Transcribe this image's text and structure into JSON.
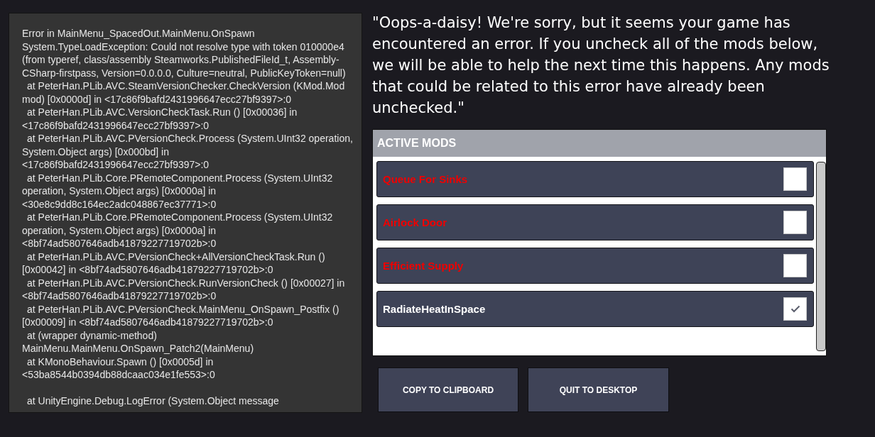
{
  "log_blocks": [
    [
      {
        "kind": "text",
        "text": "Error in MainMenu_SpacedOut.MainMenu.OnSpawn"
      },
      {
        "kind": "text",
        "text": "System.TypeLoadException: Could not resolve type with token 010000e4"
      },
      {
        "kind": "text",
        "text": "(from typeref, class/assembly Steamworks.PublishedFileId_t, Assembly-"
      },
      {
        "kind": "text",
        "text": "CSharp-firstpass, Version=0.0.0.0, Culture=neutral, PublicKeyToken=null)"
      },
      {
        "kind": "frame",
        "text": "at PeterHan.PLib.AVC.SteamVersionChecker.CheckVersion (KMod.Mod"
      },
      {
        "kind": "text",
        "text": "mod) [0x0000d] in <17c86f9bafd2431996647ecc27bf9397>:0"
      },
      {
        "kind": "frame",
        "text": "at PeterHan.PLib.AVC.VersionCheckTask.Run () [0x00036] in"
      },
      {
        "kind": "text",
        "text": "<17c86f9bafd2431996647ecc27bf9397>:0"
      },
      {
        "kind": "frame",
        "text": "at PeterHan.PLib.AVC.PVersionCheck.Process (System.UInt32 operation,"
      },
      {
        "kind": "text",
        "text": "System.Object args) [0x000bd] in"
      },
      {
        "kind": "text",
        "text": "<17c86f9bafd2431996647ecc27bf9397>:0"
      },
      {
        "kind": "frame",
        "text": "at PeterHan.PLib.Core.PRemoteComponent.Process (System.UInt32"
      },
      {
        "kind": "text",
        "text": "operation, System.Object args) [0x0000a] in"
      },
      {
        "kind": "text",
        "text": "<30e8c9dd8c164ec2adc048867ec37771>:0"
      },
      {
        "kind": "frame",
        "text": "at PeterHan.PLib.Core.PRemoteComponent.Process (System.UInt32"
      },
      {
        "kind": "text",
        "text": "operation, System.Object args) [0x0000a] in"
      },
      {
        "kind": "text",
        "text": "<8bf74ad5807646adb41879227719702b>:0"
      },
      {
        "kind": "frame",
        "text": "at PeterHan.PLib.AVC.PVersionCheck+AllVersionCheckTask.Run ()"
      },
      {
        "kind": "text",
        "text": "[0x00042] in <8bf74ad5807646adb41879227719702b>:0"
      },
      {
        "kind": "frame",
        "text": "at PeterHan.PLib.AVC.PVersionCheck.RunVersionCheck () [0x00027] in"
      },
      {
        "kind": "text",
        "text": "<8bf74ad5807646adb41879227719702b>:0"
      },
      {
        "kind": "frame",
        "text": "at PeterHan.PLib.AVC.PVersionCheck.MainMenu_OnSpawn_Postfix ()"
      },
      {
        "kind": "text",
        "text": "[0x00009] in <8bf74ad5807646adb41879227719702b>:0"
      },
      {
        "kind": "frame",
        "text": "at (wrapper dynamic-method)"
      },
      {
        "kind": "text",
        "text": "MainMenu.MainMenu.OnSpawn_Patch2(MainMenu)"
      },
      {
        "kind": "frame",
        "text": "at KMonoBehaviour.Spawn () [0x0005d] in"
      },
      {
        "kind": "text",
        "text": "<53ba8544b0394db88dcaac034e1fe553>:0"
      }
    ],
    [
      {
        "kind": "frame",
        "text": "at UnityEngine.Debug.LogError (System.Object message"
      }
    ]
  ],
  "message": "\"Oops-a-daisy! We're sorry, but it seems your game has encountered an error. If you uncheck all of the mods below, we will be able to help the next time this happens. Any mods that could be related to this error have already been unchecked.\"",
  "mods_panel": {
    "title": "ACTIVE MODS",
    "mods": [
      {
        "name": "Queue For Sinks",
        "checked": false
      },
      {
        "name": "Airlock Door",
        "checked": false
      },
      {
        "name": "Efficient Supply",
        "checked": false
      },
      {
        "name": "RadiateHeatInSpace",
        "checked": true
      }
    ]
  },
  "buttons": [
    "COPY TO CLIPBOARD",
    "QUIT TO DESKTOP"
  ]
}
